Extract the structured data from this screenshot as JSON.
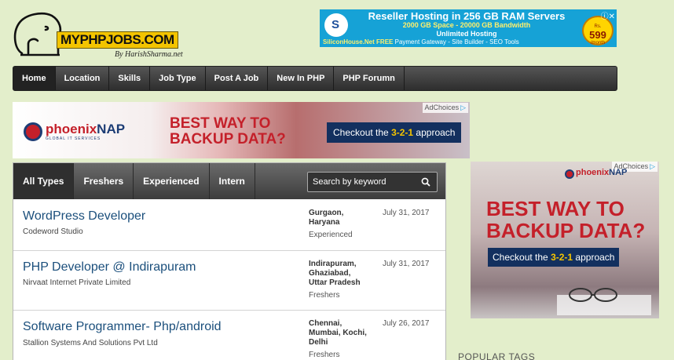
{
  "header": {
    "logo_text": "MYPHPJOBS.COM",
    "logo_byline": "By HarishSharma.net"
  },
  "top_ad": {
    "line1": "Reseller Hosting in 256 GB RAM Servers",
    "line2": "2000 GB Space - 20000 GB Bandwidth",
    "line3": "Unlimited Hosting",
    "brand": "SiliconHouse.Net",
    "free": "FREE",
    "features": "Payment Gateway - Site Builder - SEO Tools",
    "price_prefix": "Rs.",
    "price": "599",
    "price_suffix": "/month"
  },
  "nav": {
    "items": [
      {
        "label": "Home",
        "active": true
      },
      {
        "label": "Location"
      },
      {
        "label": "Skills"
      },
      {
        "label": "Job Type"
      },
      {
        "label": "Post A Job"
      },
      {
        "label": "New In PHP"
      },
      {
        "label": "PHP Forumn"
      }
    ]
  },
  "mid_ad": {
    "adchoices": "AdChoices",
    "brand_a": "phoenix",
    "brand_b": "NAP",
    "brand_sub": "GLOBAL IT SERVICES",
    "headline_1": "BEST WAY TO",
    "headline_2": "BACKUP DATA?",
    "cta_pre": "Checkout the",
    "cta_em": "3-2-1",
    "cta_post": "approach"
  },
  "jobs": {
    "tabs": [
      "All Types",
      "Freshers",
      "Experienced",
      "Intern"
    ],
    "search_placeholder": "Search by keyword",
    "listings": [
      {
        "title": "WordPress Developer",
        "company": "Codeword Studio",
        "location_lines": [
          "Gurgaon,",
          "Haryana"
        ],
        "type": "Experienced",
        "date": "July 31, 2017"
      },
      {
        "title": "PHP Developer @ Indirapuram",
        "company": "Nirvaat Internet Private Limited",
        "location_lines": [
          "Indirapuram,",
          "Ghaziabad,",
          "Uttar Pradesh"
        ],
        "type": "Freshers",
        "date": "July 31, 2017"
      },
      {
        "title": "Software Programmer- Php/android",
        "company": "Stallion Systems And Solutions Pvt Ltd",
        "location_lines": [
          "Chennai,",
          "Mumbai, Kochi,",
          "Delhi"
        ],
        "type": "Freshers",
        "date": "July 26, 2017"
      }
    ]
  },
  "side_ad": {
    "adchoices": "AdChoices",
    "brand_a": "phoenix",
    "brand_b": "NAP",
    "headline_1": "BEST WAY TO",
    "headline_2": "BACKUP DATA?",
    "cta_pre": "Checkout the",
    "cta_em": "3-2-1",
    "cta_post": "approach"
  },
  "sidebar": {
    "popular_tags_title": "POPULAR TAGS"
  }
}
